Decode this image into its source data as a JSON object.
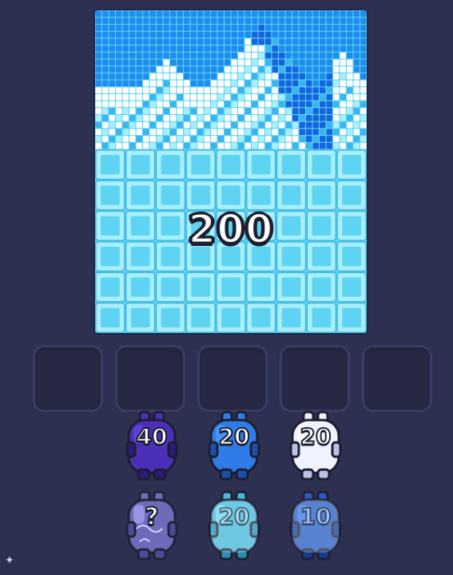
{
  "score": "200",
  "slots": [
    {
      "state": "empty"
    },
    {
      "state": "empty"
    },
    {
      "state": "empty"
    },
    {
      "state": "empty"
    },
    {
      "state": "empty"
    }
  ],
  "units": [
    {
      "label": "40",
      "color": "#4b2fb8",
      "light": "#6a4fe0",
      "dark": "#2d1b7a",
      "style": "solid"
    },
    {
      "label": "20",
      "color": "#2f7be8",
      "light": "#58a4ff",
      "dark": "#1b4fa8",
      "style": "solid"
    },
    {
      "label": "20",
      "color": "#eef3ff",
      "light": "#ffffff",
      "dark": "#b7c2e6",
      "style": "solid"
    },
    {
      "label": "?",
      "color": "#8a86e6",
      "light": "#b4b0ff",
      "dark": "#5a56b8",
      "style": "mystery"
    },
    {
      "label": "20",
      "color": "#4fd0f0",
      "light": "#8ae6ff",
      "dark": "#2a9ec4",
      "style": "frozen"
    },
    {
      "label": "10",
      "color": "#2d63d6",
      "light": "#4e86f0",
      "dark": "#1a3f9a",
      "style": "frozen"
    }
  ],
  "colors": {
    "background": "#2e3052",
    "sky": "#1f8cf0",
    "snow": "#ffffff",
    "ice_light": "#a8efff",
    "ice_mid": "#5fd3f2",
    "ice_dark": "#2aa9d8",
    "mountain_dark": "#1565e0",
    "mountain_mid": "#39b6ee"
  },
  "icons": {
    "corner": "sparkle-icon"
  }
}
